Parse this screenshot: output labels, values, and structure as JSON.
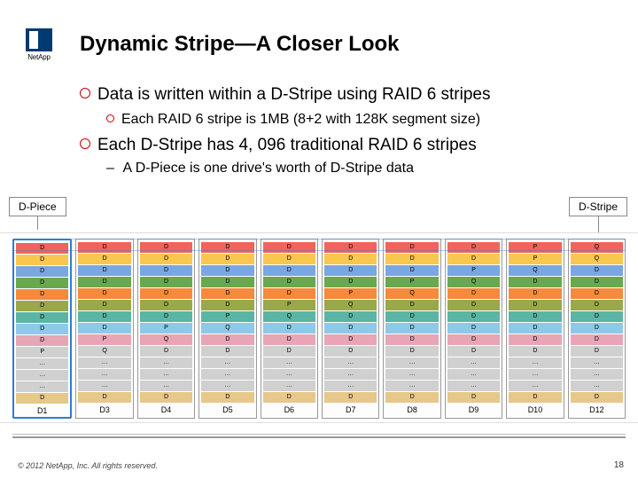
{
  "brand": {
    "name": "NetApp"
  },
  "title": "Dynamic Stripe—A Closer Look",
  "bullets": {
    "b1": "Data is written within a D-Stripe using RAID 6 stripes",
    "b2": "Each RAID 6 stripe is 1MB (8+2 with 128K segment size)",
    "b3": "Each D-Stripe has 4, 096 traditional RAID 6 stripes",
    "b4": "A D-Piece is one drive's worth of D-Stripe data"
  },
  "callouts": {
    "left": "D-Piece",
    "right": "D-Stripe"
  },
  "diagram": {
    "columns": [
      {
        "label": "D1",
        "cells": [
          {
            "v": "D",
            "c": "red"
          },
          {
            "v": "D",
            "c": "yellow"
          },
          {
            "v": "D",
            "c": "blue"
          },
          {
            "v": "D",
            "c": "green"
          },
          {
            "v": "D",
            "c": "orange"
          },
          {
            "v": "D",
            "c": "olive"
          },
          {
            "v": "D",
            "c": "teal"
          },
          {
            "v": "D",
            "c": "sky"
          },
          {
            "v": "D",
            "c": "pink"
          },
          {
            "v": "P",
            "c": "gray"
          },
          {
            "v": "…",
            "c": "gray"
          },
          {
            "v": "…",
            "c": "gray"
          },
          {
            "v": "…",
            "c": "gray"
          },
          {
            "v": "D",
            "c": "tan"
          }
        ]
      },
      {
        "label": "D3",
        "cells": [
          {
            "v": "D",
            "c": "red"
          },
          {
            "v": "D",
            "c": "yellow"
          },
          {
            "v": "D",
            "c": "blue"
          },
          {
            "v": "D",
            "c": "green"
          },
          {
            "v": "D",
            "c": "orange"
          },
          {
            "v": "D",
            "c": "olive"
          },
          {
            "v": "D",
            "c": "teal"
          },
          {
            "v": "D",
            "c": "sky"
          },
          {
            "v": "P",
            "c": "pink"
          },
          {
            "v": "Q",
            "c": "gray"
          },
          {
            "v": "…",
            "c": "gray"
          },
          {
            "v": "…",
            "c": "gray"
          },
          {
            "v": "…",
            "c": "gray"
          },
          {
            "v": "D",
            "c": "tan"
          }
        ]
      },
      {
        "label": "D4",
        "cells": [
          {
            "v": "D",
            "c": "red"
          },
          {
            "v": "D",
            "c": "yellow"
          },
          {
            "v": "D",
            "c": "blue"
          },
          {
            "v": "D",
            "c": "green"
          },
          {
            "v": "D",
            "c": "orange"
          },
          {
            "v": "D",
            "c": "olive"
          },
          {
            "v": "D",
            "c": "teal"
          },
          {
            "v": "P",
            "c": "sky"
          },
          {
            "v": "Q",
            "c": "pink"
          },
          {
            "v": "D",
            "c": "gray"
          },
          {
            "v": "…",
            "c": "gray"
          },
          {
            "v": "…",
            "c": "gray"
          },
          {
            "v": "…",
            "c": "gray"
          },
          {
            "v": "D",
            "c": "tan"
          }
        ]
      },
      {
        "label": "D5",
        "cells": [
          {
            "v": "D",
            "c": "red"
          },
          {
            "v": "D",
            "c": "yellow"
          },
          {
            "v": "D",
            "c": "blue"
          },
          {
            "v": "D",
            "c": "green"
          },
          {
            "v": "D",
            "c": "orange"
          },
          {
            "v": "D",
            "c": "olive"
          },
          {
            "v": "P",
            "c": "teal"
          },
          {
            "v": "Q",
            "c": "sky"
          },
          {
            "v": "D",
            "c": "pink"
          },
          {
            "v": "D",
            "c": "gray"
          },
          {
            "v": "…",
            "c": "gray"
          },
          {
            "v": "…",
            "c": "gray"
          },
          {
            "v": "…",
            "c": "gray"
          },
          {
            "v": "D",
            "c": "tan"
          }
        ]
      },
      {
        "label": "D6",
        "cells": [
          {
            "v": "D",
            "c": "red"
          },
          {
            "v": "D",
            "c": "yellow"
          },
          {
            "v": "D",
            "c": "blue"
          },
          {
            "v": "D",
            "c": "green"
          },
          {
            "v": "D",
            "c": "orange"
          },
          {
            "v": "P",
            "c": "olive"
          },
          {
            "v": "Q",
            "c": "teal"
          },
          {
            "v": "D",
            "c": "sky"
          },
          {
            "v": "D",
            "c": "pink"
          },
          {
            "v": "D",
            "c": "gray"
          },
          {
            "v": "…",
            "c": "gray"
          },
          {
            "v": "…",
            "c": "gray"
          },
          {
            "v": "…",
            "c": "gray"
          },
          {
            "v": "D",
            "c": "tan"
          }
        ]
      },
      {
        "label": "D7",
        "cells": [
          {
            "v": "D",
            "c": "red"
          },
          {
            "v": "D",
            "c": "yellow"
          },
          {
            "v": "D",
            "c": "blue"
          },
          {
            "v": "D",
            "c": "green"
          },
          {
            "v": "P",
            "c": "orange"
          },
          {
            "v": "Q",
            "c": "olive"
          },
          {
            "v": "D",
            "c": "teal"
          },
          {
            "v": "D",
            "c": "sky"
          },
          {
            "v": "D",
            "c": "pink"
          },
          {
            "v": "D",
            "c": "gray"
          },
          {
            "v": "…",
            "c": "gray"
          },
          {
            "v": "…",
            "c": "gray"
          },
          {
            "v": "…",
            "c": "gray"
          },
          {
            "v": "D",
            "c": "tan"
          }
        ]
      },
      {
        "label": "D8",
        "cells": [
          {
            "v": "D",
            "c": "red"
          },
          {
            "v": "D",
            "c": "yellow"
          },
          {
            "v": "D",
            "c": "blue"
          },
          {
            "v": "P",
            "c": "green"
          },
          {
            "v": "Q",
            "c": "orange"
          },
          {
            "v": "D",
            "c": "olive"
          },
          {
            "v": "D",
            "c": "teal"
          },
          {
            "v": "D",
            "c": "sky"
          },
          {
            "v": "D",
            "c": "pink"
          },
          {
            "v": "D",
            "c": "gray"
          },
          {
            "v": "…",
            "c": "gray"
          },
          {
            "v": "…",
            "c": "gray"
          },
          {
            "v": "…",
            "c": "gray"
          },
          {
            "v": "D",
            "c": "tan"
          }
        ]
      },
      {
        "label": "D9",
        "cells": [
          {
            "v": "D",
            "c": "red"
          },
          {
            "v": "D",
            "c": "yellow"
          },
          {
            "v": "P",
            "c": "blue"
          },
          {
            "v": "Q",
            "c": "green"
          },
          {
            "v": "D",
            "c": "orange"
          },
          {
            "v": "D",
            "c": "olive"
          },
          {
            "v": "D",
            "c": "teal"
          },
          {
            "v": "D",
            "c": "sky"
          },
          {
            "v": "D",
            "c": "pink"
          },
          {
            "v": "D",
            "c": "gray"
          },
          {
            "v": "…",
            "c": "gray"
          },
          {
            "v": "…",
            "c": "gray"
          },
          {
            "v": "…",
            "c": "gray"
          },
          {
            "v": "D",
            "c": "tan"
          }
        ]
      },
      {
        "label": "D10",
        "cells": [
          {
            "v": "P",
            "c": "red"
          },
          {
            "v": "P",
            "c": "yellow"
          },
          {
            "v": "Q",
            "c": "blue"
          },
          {
            "v": "D",
            "c": "green"
          },
          {
            "v": "D",
            "c": "orange"
          },
          {
            "v": "D",
            "c": "olive"
          },
          {
            "v": "D",
            "c": "teal"
          },
          {
            "v": "D",
            "c": "sky"
          },
          {
            "v": "D",
            "c": "pink"
          },
          {
            "v": "D",
            "c": "gray"
          },
          {
            "v": "…",
            "c": "gray"
          },
          {
            "v": "…",
            "c": "gray"
          },
          {
            "v": "…",
            "c": "gray"
          },
          {
            "v": "D",
            "c": "tan"
          }
        ]
      },
      {
        "label": "D12",
        "cells": [
          {
            "v": "Q",
            "c": "red"
          },
          {
            "v": "Q",
            "c": "yellow"
          },
          {
            "v": "D",
            "c": "blue"
          },
          {
            "v": "D",
            "c": "green"
          },
          {
            "v": "D",
            "c": "orange"
          },
          {
            "v": "D",
            "c": "olive"
          },
          {
            "v": "D",
            "c": "teal"
          },
          {
            "v": "D",
            "c": "sky"
          },
          {
            "v": "D",
            "c": "pink"
          },
          {
            "v": "D",
            "c": "gray"
          },
          {
            "v": "…",
            "c": "gray"
          },
          {
            "v": "…",
            "c": "gray"
          },
          {
            "v": "…",
            "c": "gray"
          },
          {
            "v": "D",
            "c": "tan"
          }
        ]
      }
    ]
  },
  "footer": {
    "copyright": "© 2012 NetApp, Inc. All rights reserved.",
    "page": "18"
  }
}
